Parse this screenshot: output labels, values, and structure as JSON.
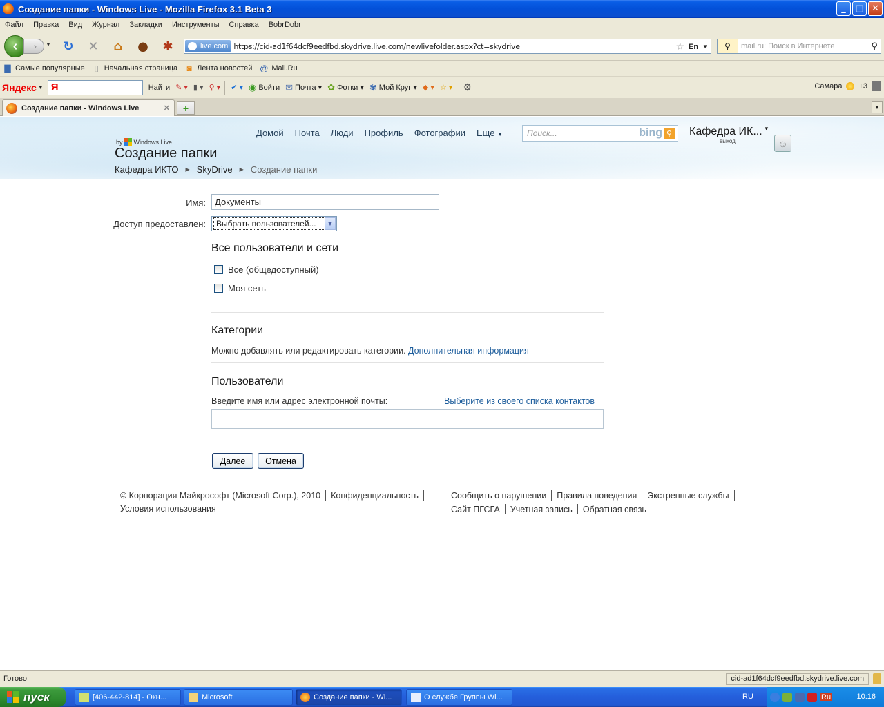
{
  "window": {
    "title": "Создание папки - Windows Live - Mozilla Firefox 3.1 Beta 3",
    "buttons": {
      "minimize": "_",
      "maximize": "□",
      "close": "✕"
    }
  },
  "menu": [
    "Файл",
    "Правка",
    "Вид",
    "Журнал",
    "Закладки",
    "Инструменты",
    "Справка",
    "BobrDobr"
  ],
  "nav": {
    "site_badge": "live.com",
    "url": "https://cid-ad1f64dcf9eedfbd.skydrive.live.com/newlivefolder.aspx?ct=skydrive",
    "lang": "En",
    "search_placeholder": "mail.ru: Поиск в Интернете"
  },
  "bookmarks": [
    "Самые популярные",
    "Начальная страница",
    "Лента новостей",
    "Mail.Ru"
  ],
  "yandex": {
    "logo": "Яндекс",
    "input_value": "Я",
    "find": "Найти",
    "items": [
      "Войти",
      "Почта",
      "Фотки",
      "Мой Круг"
    ],
    "city": "Самара",
    "temp": "+3"
  },
  "tabs": [
    {
      "label": "Создание папки - Windows Live"
    }
  ],
  "wl": {
    "nav": [
      "Домой",
      "Почта",
      "Люди",
      "Профиль",
      "Фотографии",
      "Еще"
    ],
    "search_placeholder": "Поиск...",
    "bing": "bing",
    "user": "Кафедра ИК...",
    "signout": "выход",
    "by": "by",
    "brand": "Windows Live",
    "page_title": "Создание папки",
    "breadcrumb": [
      "Кафедра ИКТО",
      "SkyDrive",
      "Создание папки"
    ]
  },
  "form": {
    "name_label": "Имя:",
    "name_value": "Документы",
    "access_label": "Доступ предоставлен:",
    "access_value": "Выбрать пользователей...",
    "section_all": "Все пользователи и сети",
    "chk_public": "Все (общедоступный)",
    "chk_network": "Моя сеть",
    "section_categories": "Категории",
    "categories_text": "Можно добавлять или редактировать категории.",
    "categories_link": "Дополнительная информация",
    "section_users": "Пользователи",
    "users_prompt": "Введите имя или адрес электронной почты:",
    "users_link": "Выберите из своего списка контактов",
    "users_value": "",
    "next": "Далее",
    "cancel": "Отмена"
  },
  "footer": {
    "row1_left": [
      "© Корпорация Майкрософт (Microsoft Corp.), 2010",
      "Конфиденциальность"
    ],
    "row2_left": [
      "Условия использования"
    ],
    "row1_right": [
      "Сообщить о нарушении",
      "Правила поведения",
      "Экстренные службы"
    ],
    "row2_right": [
      "Сайт ПГСГА",
      "Учетная запись",
      "Обратная связь"
    ]
  },
  "status": {
    "text": "Готово",
    "host": "cid-ad1f64dcf9eedfbd.skydrive.live.com"
  },
  "taskbar": {
    "start": "пуск",
    "tasks": [
      "[406-442-814] - Окн...",
      "Microsoft",
      "Создание папки - Wi...",
      "О службе Группы Wi..."
    ],
    "lang": "RU",
    "tray_lang": "Ru",
    "clock": "10:16"
  },
  "colors": {
    "link": "#1d5d9c",
    "titlebar": "#0350d8",
    "taskbar": "#245edb",
    "start": "#2f8c2f"
  }
}
